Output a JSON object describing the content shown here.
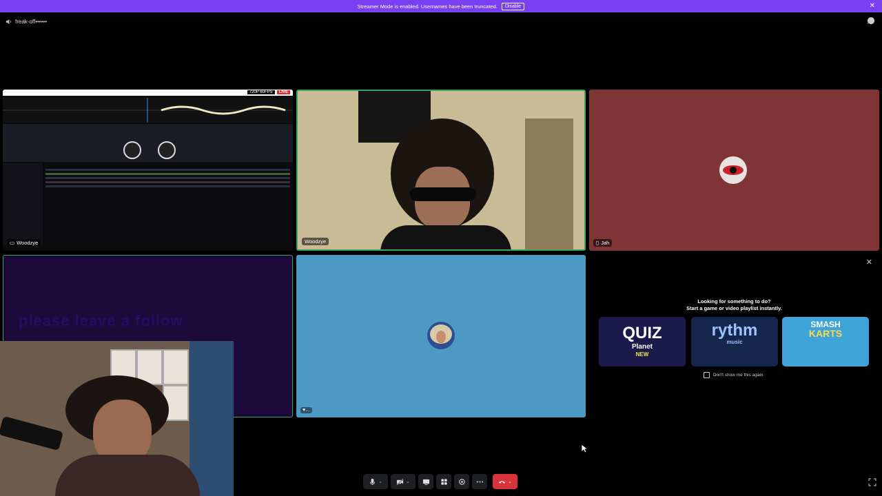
{
  "banner": {
    "message": "Streamer Mode is enabled. Usernames have been truncated.",
    "disable_label": "Disable",
    "close_glyph": "✕"
  },
  "channel": {
    "name": "freak-off••••••",
    "icon": "speaker-icon"
  },
  "tiles": {
    "screen_share": {
      "name": "Woodzye",
      "resolution": "720P 60FPS",
      "live": "LIVE"
    },
    "camera": {
      "name": "Woodzye"
    },
    "jah": {
      "name": "Jah"
    },
    "purple": {
      "overlay_text": "please leave a follow"
    },
    "blue": {
      "tag": "♥…"
    }
  },
  "activity": {
    "close_glyph": "✕",
    "title_line1": "Looking for something to do?",
    "title_line2": "Start a game or video playlist instantly.",
    "cards": [
      {
        "title": "QUIZ",
        "subtitle": "Planet",
        "badge": "NEW"
      },
      {
        "title": "rythm",
        "subtitle": "music"
      },
      {
        "title": "SMASH",
        "subtitle": "KARTS"
      }
    ],
    "dont_show_label": "Don't show me this again."
  },
  "colors": {
    "banner": "#7b3ff2",
    "speaking_border": "#3aa55d",
    "end_call": "#d8333a",
    "jah_bg": "#7f3436",
    "blue_bg": "#4c9ac4"
  }
}
